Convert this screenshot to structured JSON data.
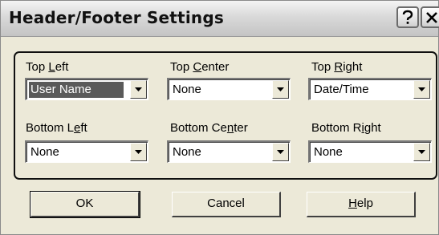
{
  "window": {
    "title": "Header/Footer Settings",
    "help_icon": "question-mark-icon",
    "close_icon": "close-x-icon"
  },
  "fields": {
    "top_left": {
      "label_pre": "Top ",
      "label_key": "L",
      "label_post": "eft",
      "value": "User Name"
    },
    "top_center": {
      "label_pre": "Top ",
      "label_key": "C",
      "label_post": "enter",
      "value": "None"
    },
    "top_right": {
      "label_pre": "Top ",
      "label_key": "R",
      "label_post": "ight",
      "value": "Date/Time"
    },
    "bottom_left": {
      "label_pre": "Bottom L",
      "label_key": "e",
      "label_post": "ft",
      "value": "None"
    },
    "bottom_center": {
      "label_pre": "Bottom Ce",
      "label_key": "n",
      "label_post": "ter",
      "value": "None"
    },
    "bottom_right": {
      "label_pre": "Bottom R",
      "label_key": "i",
      "label_post": "ght",
      "value": "None"
    }
  },
  "buttons": {
    "ok": "OK",
    "cancel": "Cancel",
    "help_key": "H",
    "help_rest": "elp"
  },
  "colors": {
    "dialog_bg": "#ece9d8",
    "selection_bg": "#5a5a5a"
  }
}
